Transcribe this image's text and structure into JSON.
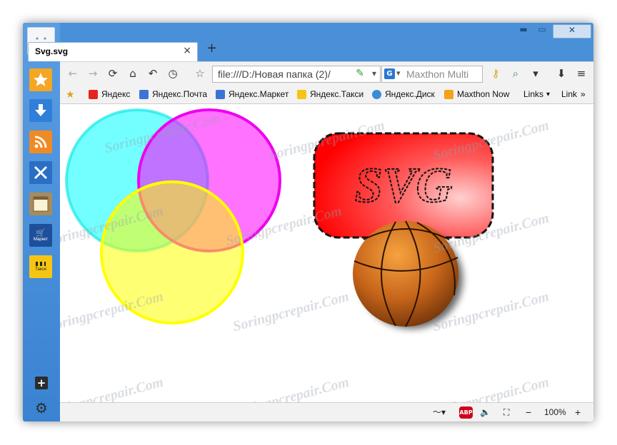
{
  "tab": {
    "title": "Svg.svg",
    "close": "×",
    "new": "+"
  },
  "window_controls": {
    "minimize": "▬",
    "maximize": "▭",
    "close": "✕"
  },
  "nav": {
    "back": "←",
    "forward": "→",
    "reload": "⟳",
    "home": "⌂",
    "undo": "↶",
    "history": "◷",
    "url": "file:///D:/Новая папка (2)/",
    "search_placeholder": "Maxthon Multi",
    "star": "☆",
    "dropdown": "▾",
    "menu": "≡",
    "download": "⬇"
  },
  "bookmarks": [
    {
      "label": "Яндекс",
      "icon": "yandex-icon",
      "color": "#e52620"
    },
    {
      "label": "Яндекс.Почта",
      "icon": "mail-icon",
      "color": "#3b74d6"
    },
    {
      "label": "Яндекс.Маркет",
      "icon": "market-icon",
      "color": "#3b74d6"
    },
    {
      "label": "Яндекс.Такси",
      "icon": "taxi-icon",
      "color": "#f6c513"
    },
    {
      "label": "Яндекс.Диск",
      "icon": "disk-icon",
      "color": "#3b8bd6"
    },
    {
      "label": "Maxthon Now",
      "icon": "maxthon-now-icon",
      "color": "#f3a21c"
    },
    {
      "label": "Links",
      "icon": "",
      "color": ""
    },
    {
      "label": "Link",
      "icon": "",
      "color": ""
    }
  ],
  "bookmarks_more": "»",
  "svg_text": "SVG",
  "watermark": "Soringpcrepair.Com",
  "status": {
    "zoom": "100%",
    "minus": "−",
    "plus": "+",
    "abp": "ABP"
  },
  "sidebar": {
    "plus": "+",
    "gear": "⚙",
    "market_label": "Маркет",
    "taxi_label": "Такси"
  },
  "colors": {
    "frame": "#4a90d9",
    "sidebar_star": "#f5a623",
    "sidebar_download": "#2f7fd8",
    "sidebar_rss": "#f08a24",
    "sidebar_tools": "#2a6fc4"
  }
}
